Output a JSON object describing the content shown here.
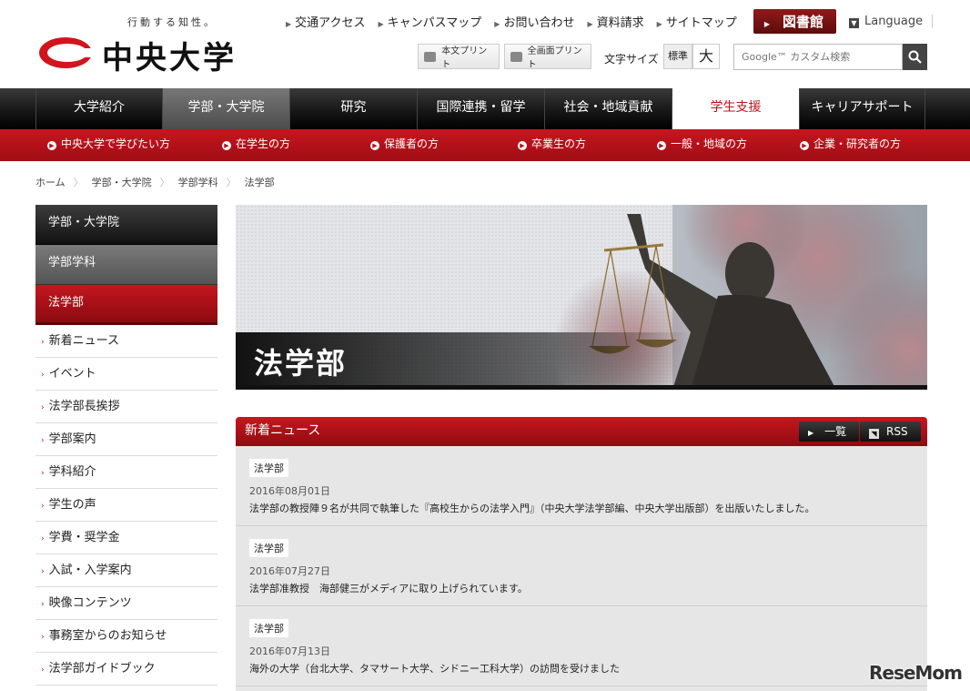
{
  "header": {
    "tagline": "行動する知性。",
    "university_name": "中央大学",
    "util_links": [
      "交通アクセス",
      "キャンパスマップ",
      "お問い合わせ",
      "資料請求",
      "サイトマップ"
    ],
    "library_label": "図書館",
    "language_label": "Language",
    "print_body_label": "本文プリント",
    "print_full_label": "全画面プリント",
    "font_size_label": "文字サイズ",
    "font_size_standard": "標準",
    "font_size_large": "大",
    "search_placeholder": "Google™ カスタム検索"
  },
  "global_nav": [
    "大学紹介",
    "学部・大学院",
    "研究",
    "国際連携・留学",
    "社会・地域貢献",
    "学生支援",
    "キャリアサポート"
  ],
  "sub_nav": [
    "中央大学で学びたい方",
    "在学生の方",
    "保護者の方",
    "卒業生の方",
    "一般・地域の方",
    "企業・研究者の方"
  ],
  "breadcrumb": [
    "ホーム",
    "学部・大学院",
    "学部学科",
    "法学部"
  ],
  "sidebar": {
    "heading1": "学部・大学院",
    "heading2": "学部学科",
    "heading3": "法学部",
    "items": [
      "新着ニュース",
      "イベント",
      "法学部長挨拶",
      "学部案内",
      "学科紹介",
      "学生の声",
      "学費・奨学金",
      "入試・入学案内",
      "映像コンテンツ",
      "事務室からのお知らせ",
      "法学部ガイドブック"
    ]
  },
  "hero": {
    "title": "法学部"
  },
  "news": {
    "heading": "新着ニュース",
    "list_label": "一覧",
    "rss_label": "RSS",
    "items": [
      {
        "category": "法学部",
        "date": "2016年08月01日",
        "title": "法学部の教授陣９名が共同で執筆した『高校生からの法学入門』（中央大学法学部編、中央大学出版部）を出版いたしました。"
      },
      {
        "category": "法学部",
        "date": "2016年07月27日",
        "title": "法学部准教授　海部健三がメディアに取り上げられています。"
      },
      {
        "category": "法学部",
        "date": "2016年07月13日",
        "title": "海外の大学（台北大学、タマサート大学、シドニー工科大学）の訪問を受けました"
      }
    ]
  },
  "watermark": "ReseMom",
  "colors": {
    "accent_red": "#c3121a",
    "nav_dark": "#1a1a1a"
  }
}
